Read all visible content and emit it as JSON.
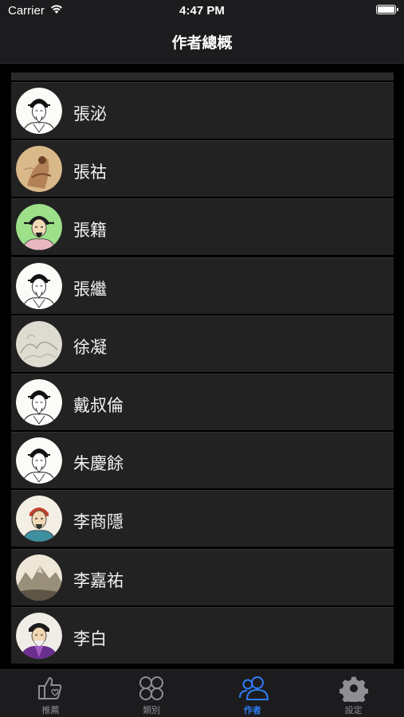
{
  "status_bar": {
    "carrier": "Carrier",
    "time": "4:47 PM",
    "wifi_icon": "wifi-icon",
    "battery_icon": "battery-icon"
  },
  "nav": {
    "title": "作者總概"
  },
  "authors": [
    {
      "name": "張泌",
      "avatar_style": "ink-sketch"
    },
    {
      "name": "張祜",
      "avatar_style": "sepia-painting"
    },
    {
      "name": "張籍",
      "avatar_style": "color-portrait-green"
    },
    {
      "name": "張繼",
      "avatar_style": "ink-sketch"
    },
    {
      "name": "徐凝",
      "avatar_style": "faded-landscape"
    },
    {
      "name": "戴叔倫",
      "avatar_style": "ink-sketch"
    },
    {
      "name": "朱慶餘",
      "avatar_style": "ink-sketch"
    },
    {
      "name": "李商隱",
      "avatar_style": "color-portrait-teal"
    },
    {
      "name": "李嘉祐",
      "avatar_style": "mountain-landscape"
    },
    {
      "name": "李白",
      "avatar_style": "color-portrait-purple"
    }
  ],
  "tabs": [
    {
      "label": "推薦",
      "icon": "thumbs-up-icon",
      "active": false
    },
    {
      "label": "類別",
      "icon": "grid-icon",
      "active": false
    },
    {
      "label": "作者",
      "icon": "people-icon",
      "active": true
    },
    {
      "label": "設定",
      "icon": "gear-icon",
      "active": false
    }
  ],
  "colors": {
    "background": "#000000",
    "bar": "#1c1c1e",
    "cell": "#222222",
    "accent": "#2f7cf6",
    "inactive": "#8e8e93"
  }
}
